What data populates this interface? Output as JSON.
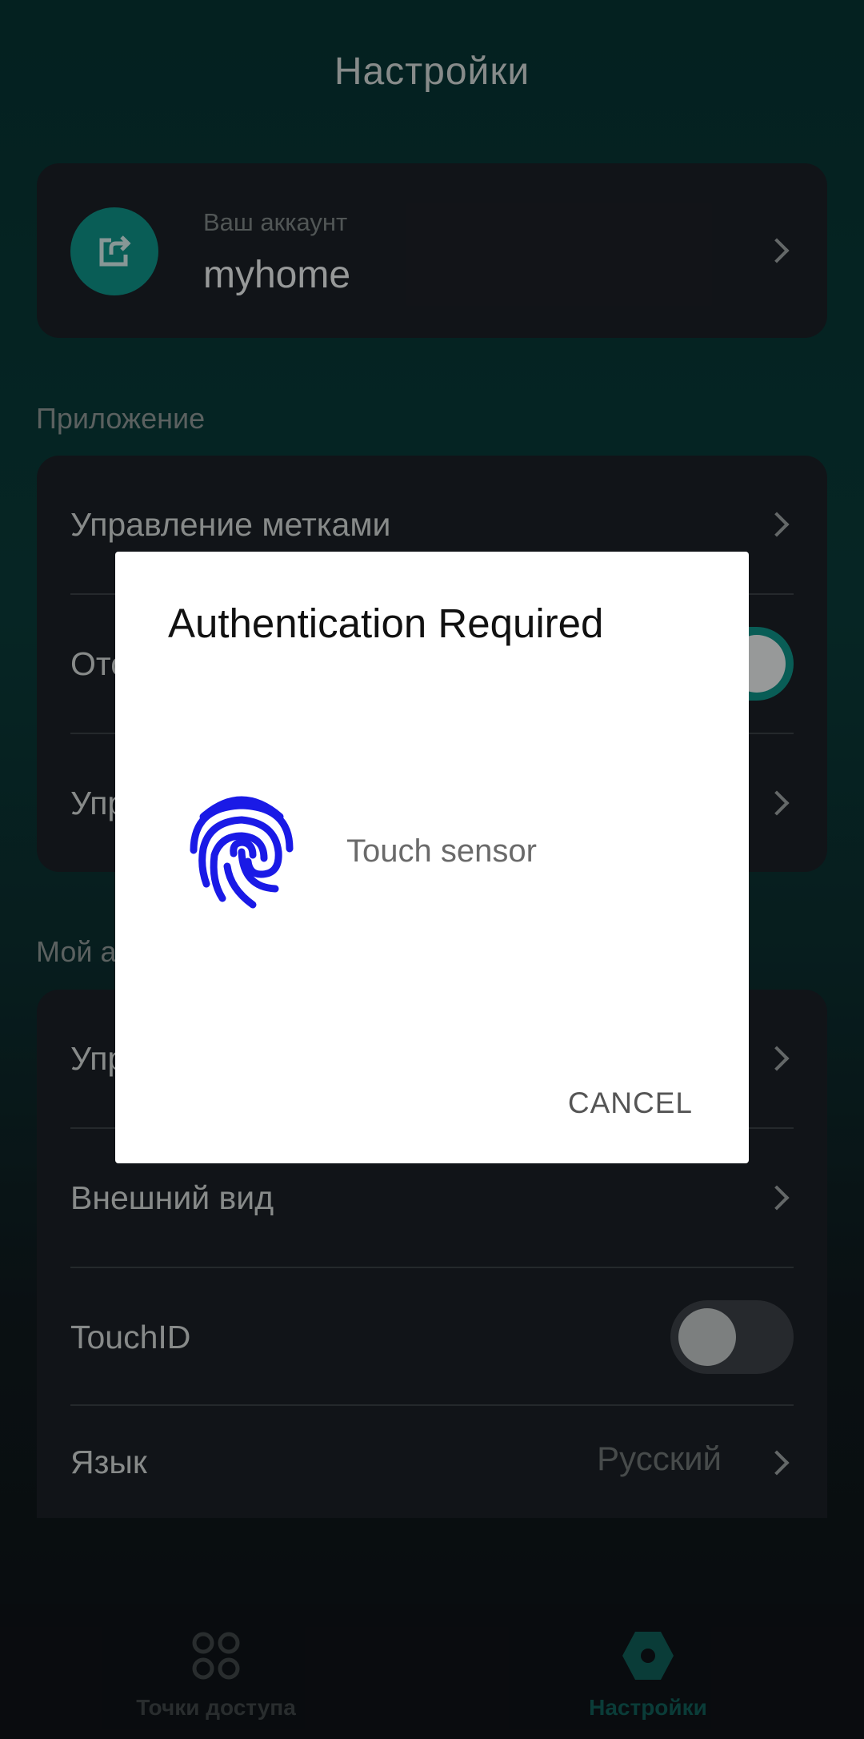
{
  "header": {
    "title": "Настройки"
  },
  "account": {
    "subtitle": "Ваш аккаунт",
    "name": "myhome"
  },
  "sections": {
    "app": {
      "label": "Приложение",
      "items": [
        {
          "label": "Управление метками"
        },
        {
          "label": "Отс"
        },
        {
          "label": "Упр"
        }
      ]
    },
    "my_account": {
      "label": "Мой а",
      "items": [
        {
          "label": "Упр"
        },
        {
          "label": "Внешний вид"
        },
        {
          "label": "TouchID"
        },
        {
          "label": "Язык",
          "value": "Русский"
        }
      ]
    }
  },
  "dialog": {
    "title": "Authentication Required",
    "message": "Touch sensor",
    "cancel_label": "CANCEL"
  },
  "bottom_nav": {
    "items": [
      {
        "label": "Точки доступа",
        "icon": "grid-icon"
      },
      {
        "label": "Настройки",
        "icon": "hexagon-settings-icon"
      }
    ]
  },
  "colors": {
    "accent": "#0f8f84",
    "fingerprint": "#1a1ae6"
  }
}
